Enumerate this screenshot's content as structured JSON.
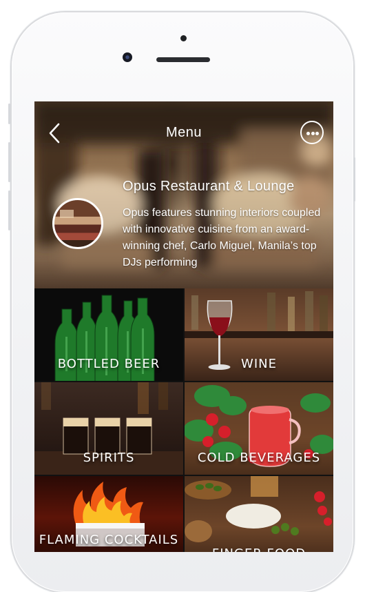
{
  "header": {
    "title": "Menu"
  },
  "restaurant": {
    "name": "Opus Restaurant & Lounge",
    "description": "Opus features stunning interiors coupled with innovative cuisine from an award-winning chef, Carlo Miguel, Manila’s top DJs performing"
  },
  "categories": [
    {
      "label": "BOTTLED BEER"
    },
    {
      "label": "WINE"
    },
    {
      "label": "SPIRITS"
    },
    {
      "label": "COLD BEVERAGES"
    },
    {
      "label": "FLAMING COCKTAILS"
    },
    {
      "label": "FINGER FOOD"
    }
  ],
  "icons": {
    "back": "chevron-left-icon",
    "more": "more-horizontal-circle-icon"
  },
  "colors": {
    "text": "#ffffff",
    "phone_frame": "#f1f2f4"
  }
}
